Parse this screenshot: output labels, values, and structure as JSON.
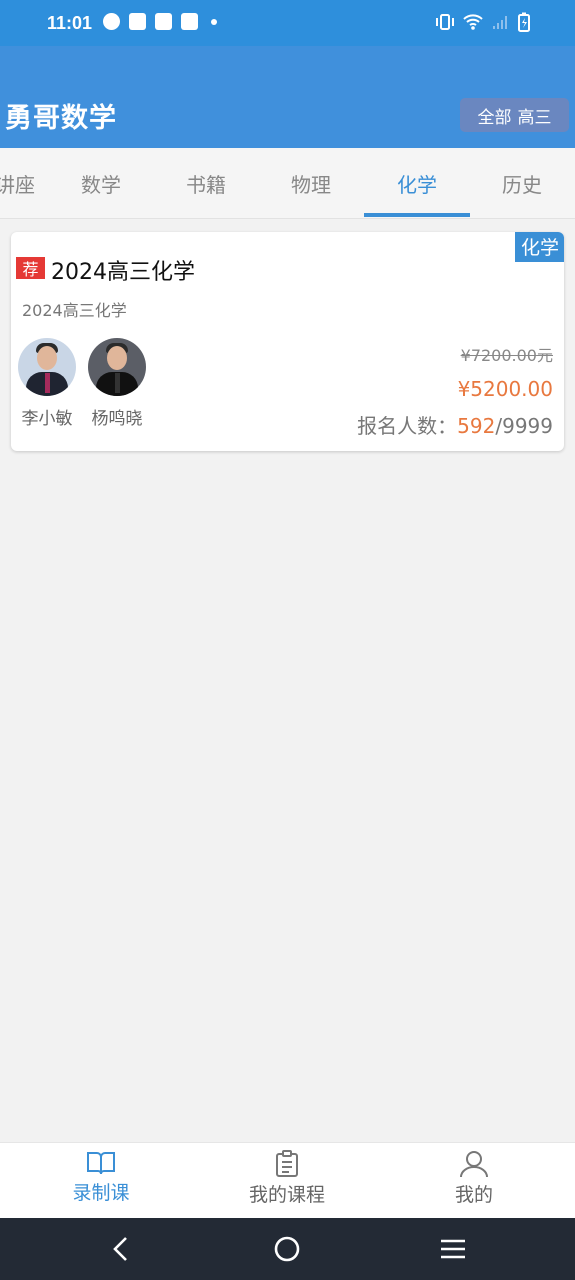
{
  "status_bar": {
    "time": "11:01",
    "left_icons": [
      "speedometer-icon",
      "shopping-bag-icon",
      "shopping-bag-icon",
      "shopping-bag-icon",
      "dot-icon"
    ],
    "right_icons": [
      "vibrate-icon",
      "wifi-icon",
      "signal-icon",
      "battery-charging-icon"
    ]
  },
  "header": {
    "title": "勇哥数学",
    "filter_all": "全部",
    "filter_grade": "高三"
  },
  "tabs": [
    {
      "label": "讲座",
      "active": false
    },
    {
      "label": "数学",
      "active": false
    },
    {
      "label": "书籍",
      "active": false
    },
    {
      "label": "物理",
      "active": false
    },
    {
      "label": "化学",
      "active": true
    },
    {
      "label": "历史",
      "active": false
    }
  ],
  "course": {
    "subject_tag": "化学",
    "badge": "荐",
    "title": "2024高三化学",
    "subtitle": "2024高三化学",
    "teachers": [
      {
        "name": "李小敏"
      },
      {
        "name": "杨鸣晓"
      }
    ],
    "original_price": "¥7200.00元",
    "price": "¥5200.00",
    "enroll_label": "报名人数：",
    "enroll_count": "592",
    "enroll_capacity": "/9999"
  },
  "bottom_nav": [
    {
      "label": "录制课",
      "icon": "open-book-icon",
      "active": true
    },
    {
      "label": "我的课程",
      "icon": "clipboard-icon",
      "active": false
    },
    {
      "label": "我的",
      "icon": "user-icon",
      "active": false
    }
  ],
  "colors": {
    "primary": "#3a8fd6",
    "appbar": "#4090dc",
    "price": "#e8783f",
    "badge": "#e53935"
  }
}
